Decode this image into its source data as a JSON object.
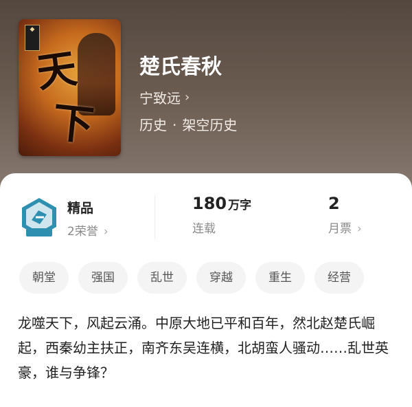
{
  "book": {
    "title": "楚氏春秋",
    "author": "宁致远",
    "genre_main": "历史",
    "genre_sub": "架空历史",
    "cover_chars": [
      "天",
      "下"
    ]
  },
  "stats": {
    "honor": {
      "label": "精品",
      "sub": "2荣誉"
    },
    "words": {
      "value": "180",
      "unit": "万字",
      "label": "连载"
    },
    "votes": {
      "value": "2",
      "label": "月票"
    }
  },
  "tags": [
    "朝堂",
    "强国",
    "乱世",
    "穿越",
    "重生",
    "经营"
  ],
  "description": "龙噬天下，风起云涌。中原大地已平和百年，然北赵楚氏崛起，西秦幼主扶正，南齐东吴连横，北胡蛮人骚动……乱世英豪，谁与争锋？",
  "colors": {
    "header_bg": "#6a5b50",
    "text_primary": "#222222",
    "text_secondary": "#8a8a8a",
    "tag_bg": "#f4f4f4",
    "honor_badge": "#2f8fb0"
  },
  "icons": {
    "chevron": "chevron-right-icon",
    "honor": "honor-badge-icon"
  }
}
